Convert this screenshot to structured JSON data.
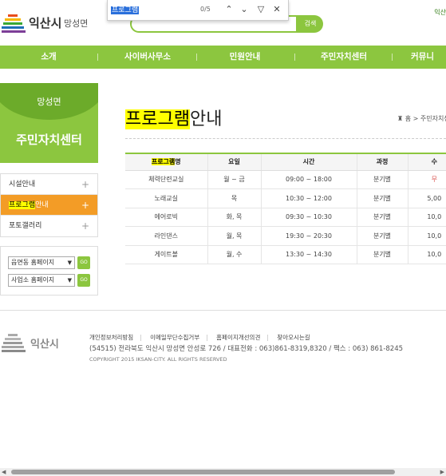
{
  "header": {
    "logo_text": "익산시",
    "logo_sub": "망성면",
    "top_right": "익산",
    "search_button": "검색"
  },
  "findbar": {
    "query": "프로그램",
    "count": "0/5"
  },
  "nav": [
    "소개",
    "사이버사무소",
    "민원안내",
    "주민자치센터",
    "커뮤니"
  ],
  "sidebar": {
    "sub_title": "망성면",
    "main_title": "주민자치센터",
    "items": [
      {
        "label": "시설안내"
      },
      {
        "label_hl": "프로그램",
        "label_rest": "안내"
      },
      {
        "label": "포토갤러리"
      }
    ],
    "selects": [
      "읍면동 홈페이지",
      "사업소 홈페이지"
    ],
    "go_label": "GO"
  },
  "content": {
    "title_hl": "프로그램",
    "title_rest": "안내",
    "breadcrumb": "홈 > 주민자치센"
  },
  "table": {
    "headers": [
      {
        "hl": "프로그램",
        "rest": "명"
      },
      "요일",
      "시간",
      "과정",
      "수"
    ],
    "rows": [
      [
        "체력단련교실",
        "월 ~ 금",
        "09:00 ~ 18:00",
        "분기별",
        "무"
      ],
      [
        "노래교실",
        "목",
        "10:30 ~ 12:00",
        "분기별",
        "5,00"
      ],
      [
        "에어로빅",
        "화, 목",
        "09:30 ~ 10:30",
        "분기별",
        "10,0"
      ],
      [
        "라인댄스",
        "월, 목",
        "19:30 ~ 20:30",
        "분기별",
        "10,0"
      ],
      [
        "게이트볼",
        "월, 수",
        "13:30 ~ 14:30",
        "분기별",
        "10,0"
      ]
    ]
  },
  "footer": {
    "logo_text": "익산시",
    "links": [
      "개인정보처리방침",
      "이메일무단수집거부",
      "홈페이지개선의견",
      "찾아오시는길"
    ],
    "address": "(54515) 전라북도 익산시 망성면 안성로 726 / 대표전화 : 063)861-8319,8320 / 팩스 : 063) 861-8245",
    "copyright": "COPYRIGHT 2015 IKSAN-CITY. ALL RIGHTS RESERVED"
  },
  "colors": {
    "green": "#8cc63f",
    "orange": "#f39c26",
    "highlight": "#ffff00"
  }
}
